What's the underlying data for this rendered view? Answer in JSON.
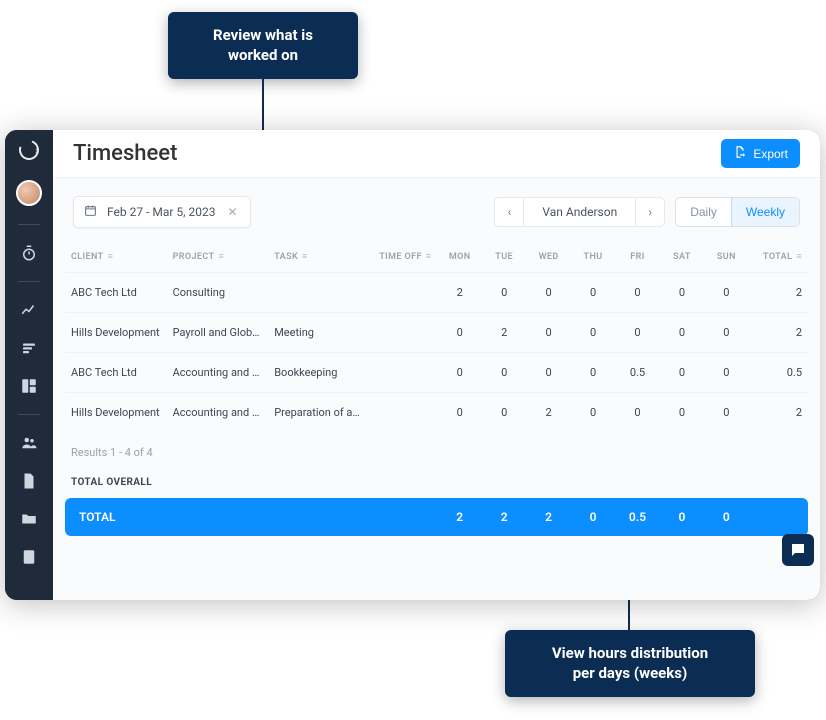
{
  "annotations": {
    "top": "Review what is\nworked on",
    "bottom": "View hours  distribution\nper days (weeks)"
  },
  "header": {
    "title": "Timesheet",
    "export_label": "Export"
  },
  "toolbar": {
    "date_range": "Feb 27 - Mar 5, 2023",
    "person_label": "Van Anderson",
    "view_daily": "Daily",
    "view_weekly": "Weekly"
  },
  "columns": {
    "client": "CLIENT",
    "project": "PROJECT",
    "task": "TASK",
    "time_off": "TIME OFF",
    "mon": "MON",
    "tue": "TUE",
    "wed": "WED",
    "thu": "THU",
    "fri": "FRI",
    "sat": "SAT",
    "sun": "SUN",
    "total": "TOTAL"
  },
  "rows": [
    {
      "client": "ABC Tech Ltd",
      "project": "Consulting",
      "task": "",
      "mon": "2",
      "tue": "0",
      "wed": "0",
      "thu": "0",
      "fri": "0",
      "sat": "0",
      "sun": "0",
      "total": "2"
    },
    {
      "client": "Hills Development",
      "project": "Payroll and Glob…",
      "task": "Meeting",
      "mon": "0",
      "tue": "2",
      "wed": "0",
      "thu": "0",
      "fri": "0",
      "sat": "0",
      "sun": "0",
      "total": "2"
    },
    {
      "client": "ABC Tech Ltd",
      "project": "Accounting and …",
      "task": "Bookkeeping",
      "mon": "0",
      "tue": "0",
      "wed": "0",
      "thu": "0",
      "fri": "0.5",
      "sat": "0",
      "sun": "0",
      "total": "0.5"
    },
    {
      "client": "Hills Development",
      "project": "Accounting and …",
      "task": "Preparation of a…",
      "mon": "0",
      "tue": "0",
      "wed": "2",
      "thu": "0",
      "fri": "0",
      "sat": "0",
      "sun": "0",
      "total": "2"
    }
  ],
  "results_text": "Results 1 - 4 of 4",
  "overall_label": "TOTAL OVERALL",
  "total_row": {
    "label": "TOTAL",
    "mon": "2",
    "tue": "2",
    "wed": "2",
    "thu": "0",
    "fri": "0.5",
    "sat": "0",
    "sun": "0",
    "total": ""
  }
}
